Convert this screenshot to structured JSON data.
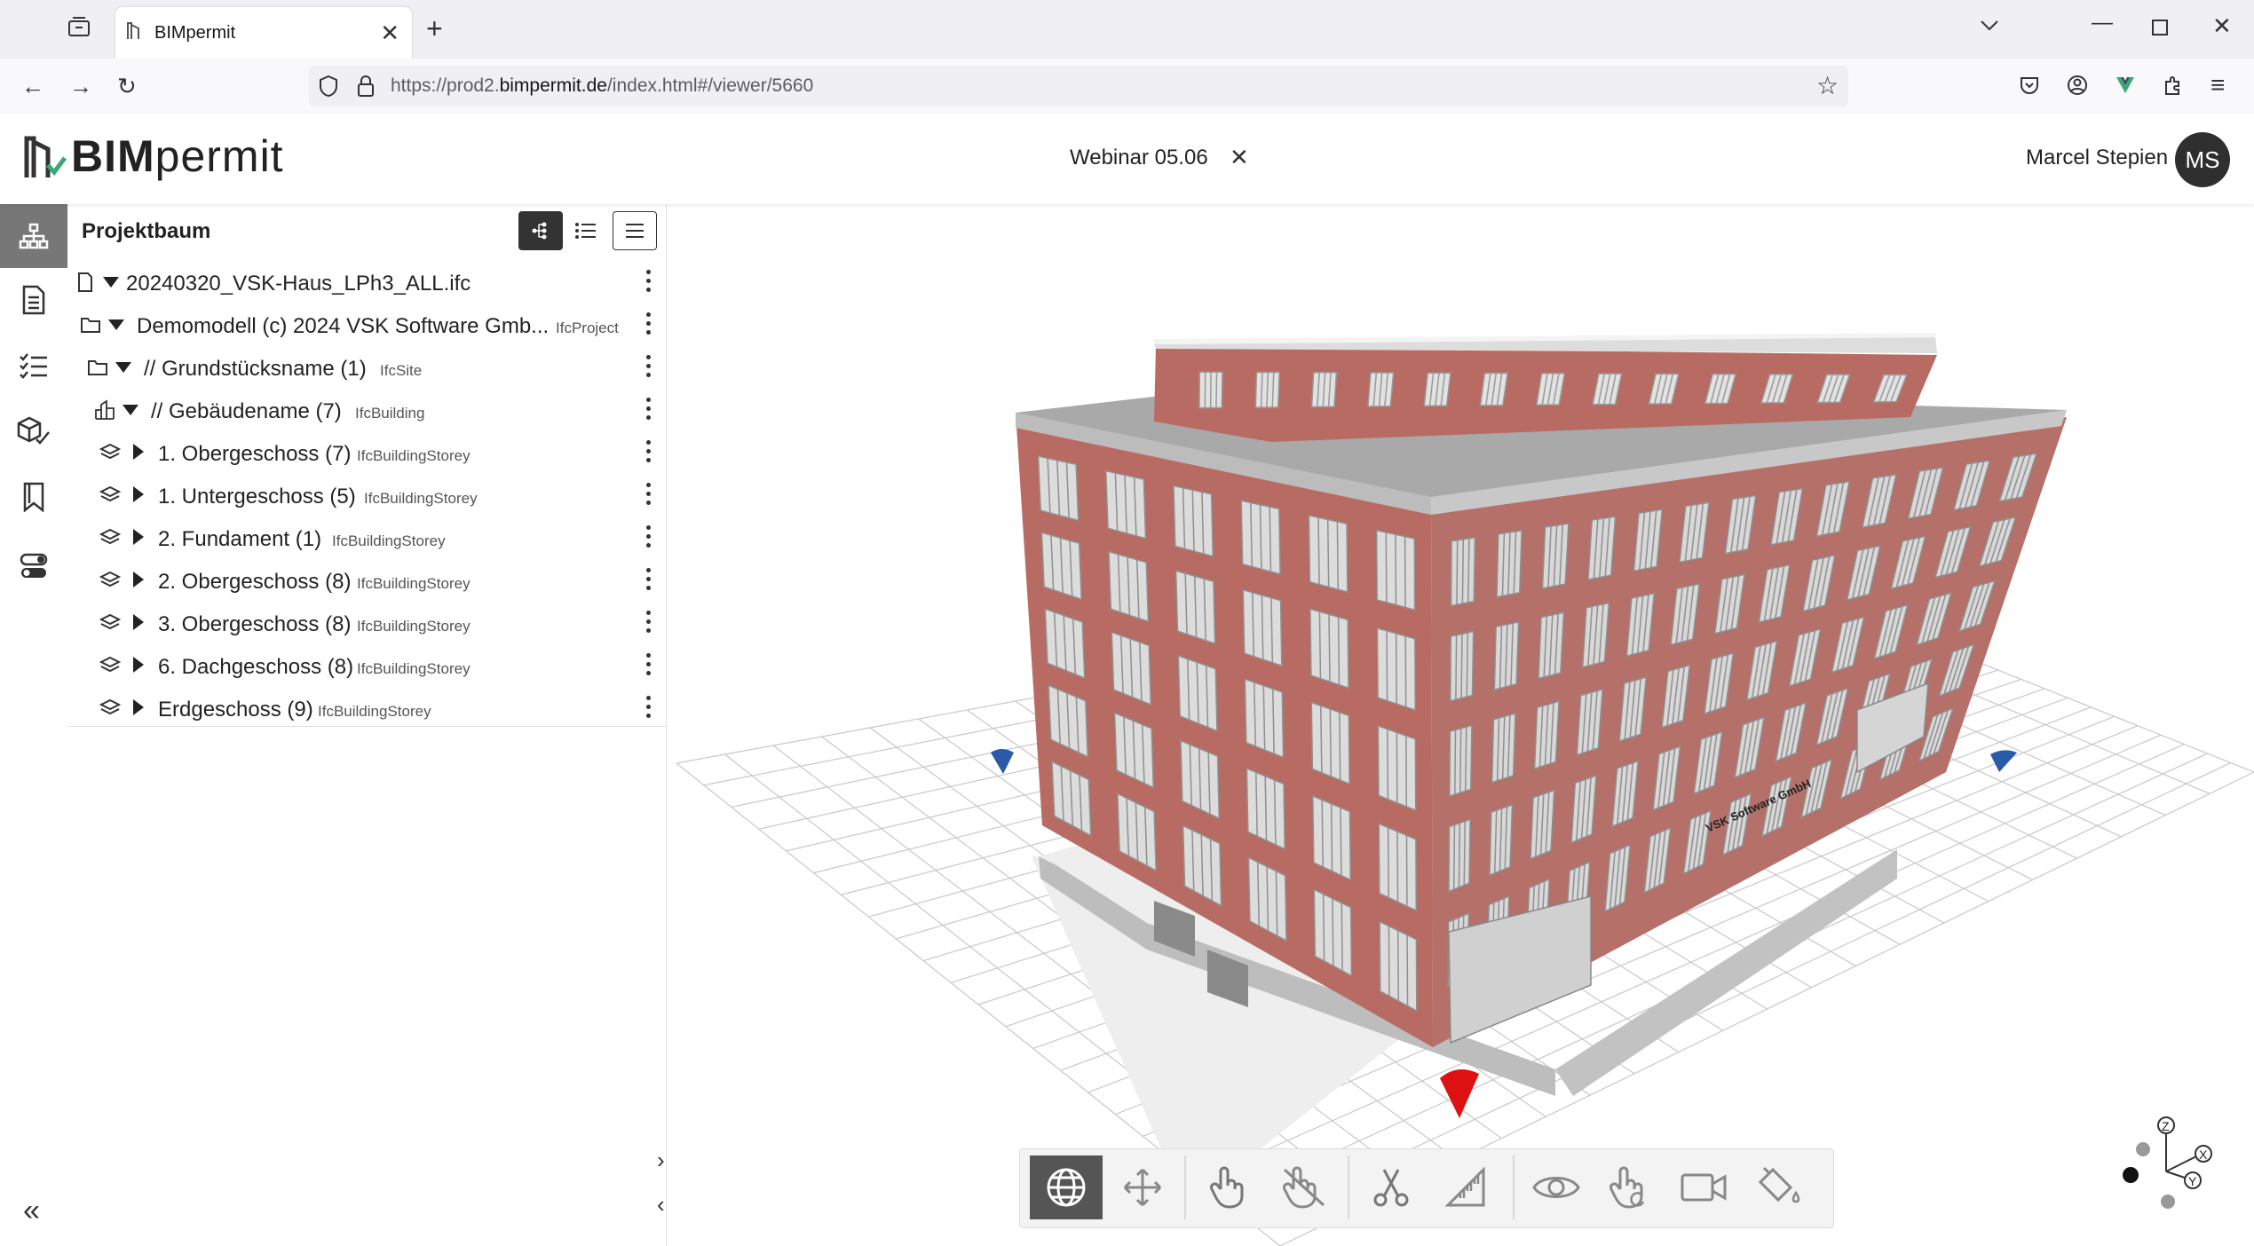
{
  "browser": {
    "tab_title": "BIMpermit",
    "url_prefix": "https://prod2.",
    "url_domain": "bimpermit.de",
    "url_path": "/index.html#/viewer/5660"
  },
  "app": {
    "logo_bim": "BIM",
    "logo_permit": "permit",
    "project_title": "Webinar 05.06",
    "user_name": "Marcel Stepien",
    "user_initials": "MS"
  },
  "panel": {
    "title": "Projektbaum",
    "rows": [
      {
        "label": "20240320_VSK-Haus_LPh3_ALL.ifc",
        "type": ""
      },
      {
        "label": "Demomodell (c) 2024 VSK Software Gmb...",
        "type": "IfcProject"
      },
      {
        "label": "// Grundstücksname (1)",
        "type": "IfcSite"
      },
      {
        "label": "// Gebäudename (7)",
        "type": "IfcBuilding"
      },
      {
        "label": "1. Obergeschoss (7)",
        "type": "IfcBuildingStorey"
      },
      {
        "label": "1. Untergeschoss (5)",
        "type": "IfcBuildingStorey"
      },
      {
        "label": "2. Fundament (1)",
        "type": "IfcBuildingStorey"
      },
      {
        "label": "2. Obergeschoss (8)",
        "type": "IfcBuildingStorey"
      },
      {
        "label": "3. Obergeschoss (8)",
        "type": "IfcBuildingStorey"
      },
      {
        "label": "6. Dachgeschoss (8)",
        "type": "IfcBuildingStorey"
      },
      {
        "label": "Erdgeschoss (9)",
        "type": "IfcBuildingStorey"
      }
    ]
  },
  "viewer": {
    "building_sign": "VSK Software GmbH",
    "axis_labels": {
      "z": "Z",
      "x": "X",
      "y": "Y"
    }
  },
  "colors": {
    "facade": "#b86b63",
    "roof": "#a9a9a9",
    "active_dark": "#333333",
    "cone_red": "#dd1111",
    "cone_blue": "#2a5aa8"
  }
}
